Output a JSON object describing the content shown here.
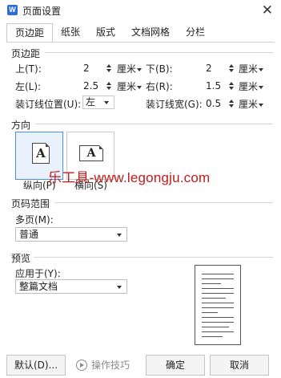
{
  "window": {
    "title": "页面设置",
    "app_icon": "W"
  },
  "tabs": [
    {
      "label": "页边距",
      "active": true
    },
    {
      "label": "纸张"
    },
    {
      "label": "版式"
    },
    {
      "label": "文档网格"
    },
    {
      "label": "分栏"
    }
  ],
  "margins": {
    "section_title": "页边距",
    "top": {
      "label": "上(T):",
      "value": "2",
      "unit": "厘米"
    },
    "bottom": {
      "label": "下(B):",
      "value": "2",
      "unit": "厘米"
    },
    "left": {
      "label": "左(L):",
      "value": "2.5",
      "unit": "厘米"
    },
    "right": {
      "label": "右(R):",
      "value": "1.5",
      "unit": "厘米"
    },
    "gutter_position": {
      "label": "装订线位置(U):",
      "value": "左"
    },
    "gutter_width": {
      "label": "装订线宽(G):",
      "value": "0.5",
      "unit": "厘米"
    }
  },
  "orientation": {
    "section_title": "方向",
    "portrait": {
      "label": "纵向(P)",
      "glyph": "A",
      "selected": true
    },
    "landscape": {
      "label": "横向(S)",
      "glyph": "A"
    }
  },
  "watermark": {
    "text": "乐工具-www.legongju.com"
  },
  "pages": {
    "section_title": "页码范围",
    "multiple_label": "多页(M):",
    "multiple_value": "普通"
  },
  "preview": {
    "section_title": "预览",
    "apply_label": "应用于(Y):",
    "apply_value": "整篇文档"
  },
  "footer": {
    "default_button": "默认(D)...",
    "tips_label": "操作技巧",
    "ok_button": "确定",
    "cancel_button": "取消"
  },
  "colors": {
    "accent": "#4a90e2",
    "watermark": "#c21b1b",
    "app_icon": "#2d6cdf"
  }
}
